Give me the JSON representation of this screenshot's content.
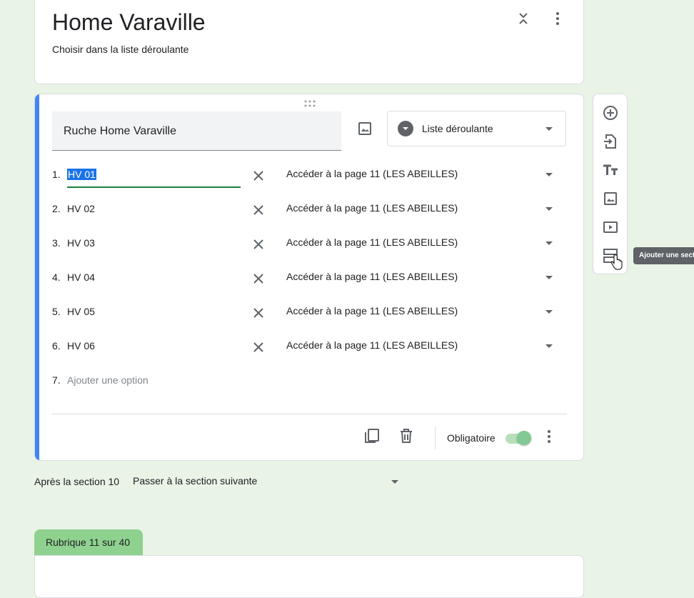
{
  "section": {
    "title": "Home Varaville",
    "description": "Choisir dans la liste déroulante"
  },
  "question": {
    "title": "Ruche Home Varaville",
    "type_label": "Liste déroulante",
    "options": [
      {
        "num": "1.",
        "text": "HV 01",
        "navigation": "Accéder à la page 11 (LES ABEILLES)"
      },
      {
        "num": "2.",
        "text": "HV 02",
        "navigation": "Accéder à la page 11 (LES ABEILLES)"
      },
      {
        "num": "3.",
        "text": "HV 03",
        "navigation": "Accéder à la page 11 (LES ABEILLES)"
      },
      {
        "num": "4.",
        "text": "HV 04",
        "navigation": "Accéder à la page 11 (LES ABEILLES)"
      },
      {
        "num": "5.",
        "text": "HV 05",
        "navigation": "Accéder à la page 11 (LES ABEILLES)"
      },
      {
        "num": "6.",
        "text": "HV 06",
        "navigation": "Accéder à la page 11 (LES ABEILLES)"
      }
    ],
    "add_option": {
      "num": "7.",
      "placeholder": "Ajouter une option"
    },
    "required_label": "Obligatoire",
    "required_on": true
  },
  "toolbar": {
    "tooltip": "Ajouter une section",
    "items": [
      "add-question-icon",
      "import-questions-icon",
      "add-title-icon",
      "add-image-icon",
      "add-video-icon",
      "add-section-icon"
    ]
  },
  "after_section": {
    "label": "Après la section 10",
    "value": "Passer à la section suivante"
  },
  "next_section": {
    "tab_label": "Rubrique 11 sur 40"
  },
  "colors": {
    "accent_bar": "#4285f4",
    "background": "#e9f3e6",
    "section_tab": "#8fd18f",
    "toggle_on": "#81c995",
    "selection": "#1a73e8",
    "underline_focus": "#188038"
  }
}
